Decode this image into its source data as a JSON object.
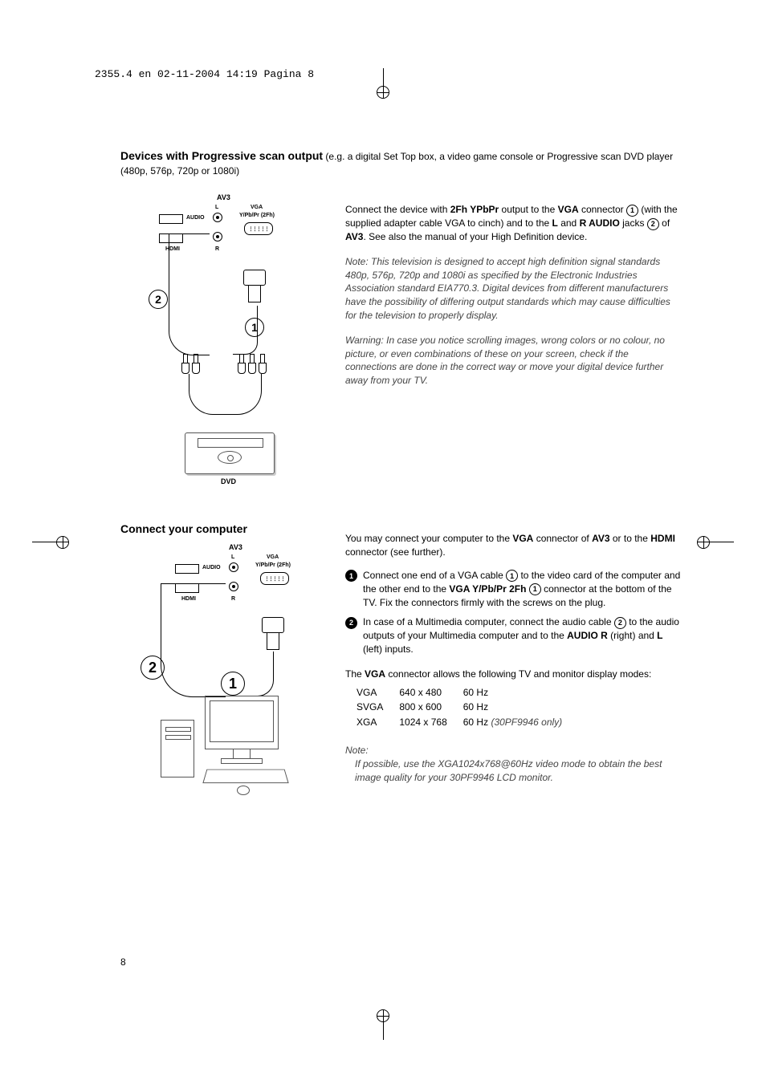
{
  "prepress": "2355.4 en  02-11-2004  14:19  Pagina 8",
  "page_number": "8",
  "section1": {
    "title": "Devices with Progressive scan output",
    "title_suffix": " (e.g. a digital Set Top box, a video game console or Progressive scan DVD player (480p, 576p, 720p or 1080i)",
    "para1_pre": "Connect the device with ",
    "para1_b1": "2Fh YPbPr",
    "para1_mid1": " output to the ",
    "para1_b2": "VGA",
    "para1_mid2": " connector ",
    "para1_num1": "1",
    "para1_mid3": " (with the supplied adapter cable VGA to cinch) and to the ",
    "para1_b3": "L",
    "para1_mid4": " and ",
    "para1_b4": "R AUDIO",
    "para1_mid5": " jacks ",
    "para1_num2": "2",
    "para1_mid6": " of ",
    "para1_b5": "AV3",
    "para1_end": ". See also the manual of your High Definition device.",
    "note1": "Note: This television is designed to accept high definition signal standards 480p, 576p, 720p and 1080i as specified by the Electronic Industries Association standard EIA770.3. Digital devices from different manufacturers have the possibility of differing output standards which may cause difficulties for the television to properly display.",
    "warning": "Warning: In case you notice scrolling images, wrong colors or no colour, no picture, or even combinations of these on your screen, check if the connections are done in the correct way or move your digital device further away from your TV.",
    "diagram": {
      "av3": "AV3",
      "l": "L",
      "r": "R",
      "audio": "AUDIO",
      "hdmi": "HDMI",
      "vga": "VGA",
      "ypbpr": "Y/Pb/Pr (2Fh)",
      "dvd": "DVD",
      "callout1": "1",
      "callout2": "2"
    }
  },
  "section2": {
    "heading": "Connect your computer",
    "intro_pre": "You may connect your computer to the ",
    "intro_b1": "VGA",
    "intro_mid1": " connector of ",
    "intro_b2": "AV3",
    "intro_mid2": " or to the ",
    "intro_b3": "HDMI",
    "intro_end": " connector (see further).",
    "step1_pre": "Connect one end of a VGA cable ",
    "step1_n1": "1",
    "step1_mid1": " to the video card of the computer and the other end to the ",
    "step1_b1": "VGA Y/Pb/Pr 2Fh",
    "step1_mid2": " ",
    "step1_n2": "1",
    "step1_mid3": " connector at the bottom of the TV. Fix the connectors firmly with the screws on the plug.",
    "step2_pre": "In case of a Multimedia computer, connect the audio cable ",
    "step2_n1": "2",
    "step2_mid1": " to the audio outputs of your Multimedia computer and to the ",
    "step2_b1": "AUDIO R",
    "step2_mid2": " (right) and ",
    "step2_b2": "L",
    "step2_end": " (left) inputs.",
    "modes_intro_pre": "The ",
    "modes_intro_b": "VGA",
    "modes_intro_end": " connector allows the following TV and monitor display modes:",
    "modes": [
      {
        "name": "VGA",
        "res": "640 x 480",
        "hz": "60 Hz",
        "extra": ""
      },
      {
        "name": "SVGA",
        "res": "800 x 600",
        "hz": "60 Hz",
        "extra": ""
      },
      {
        "name": "XGA",
        "res": "1024 x 768",
        "hz": "60 Hz",
        "extra": "(30PF9946 only)"
      }
    ],
    "note_label": "Note:",
    "note_body": "If possible, use the XGA1024x768@60Hz video mode to obtain the best image quality for your 30PF9946 LCD monitor.",
    "diagram": {
      "av3": "AV3",
      "l": "L",
      "r": "R",
      "audio": "AUDIO",
      "hdmi": "HDMI",
      "vga": "VGA",
      "ypbpr": "Y/Pb/Pr (2Fh)",
      "callout1": "1",
      "callout2": "2"
    }
  }
}
